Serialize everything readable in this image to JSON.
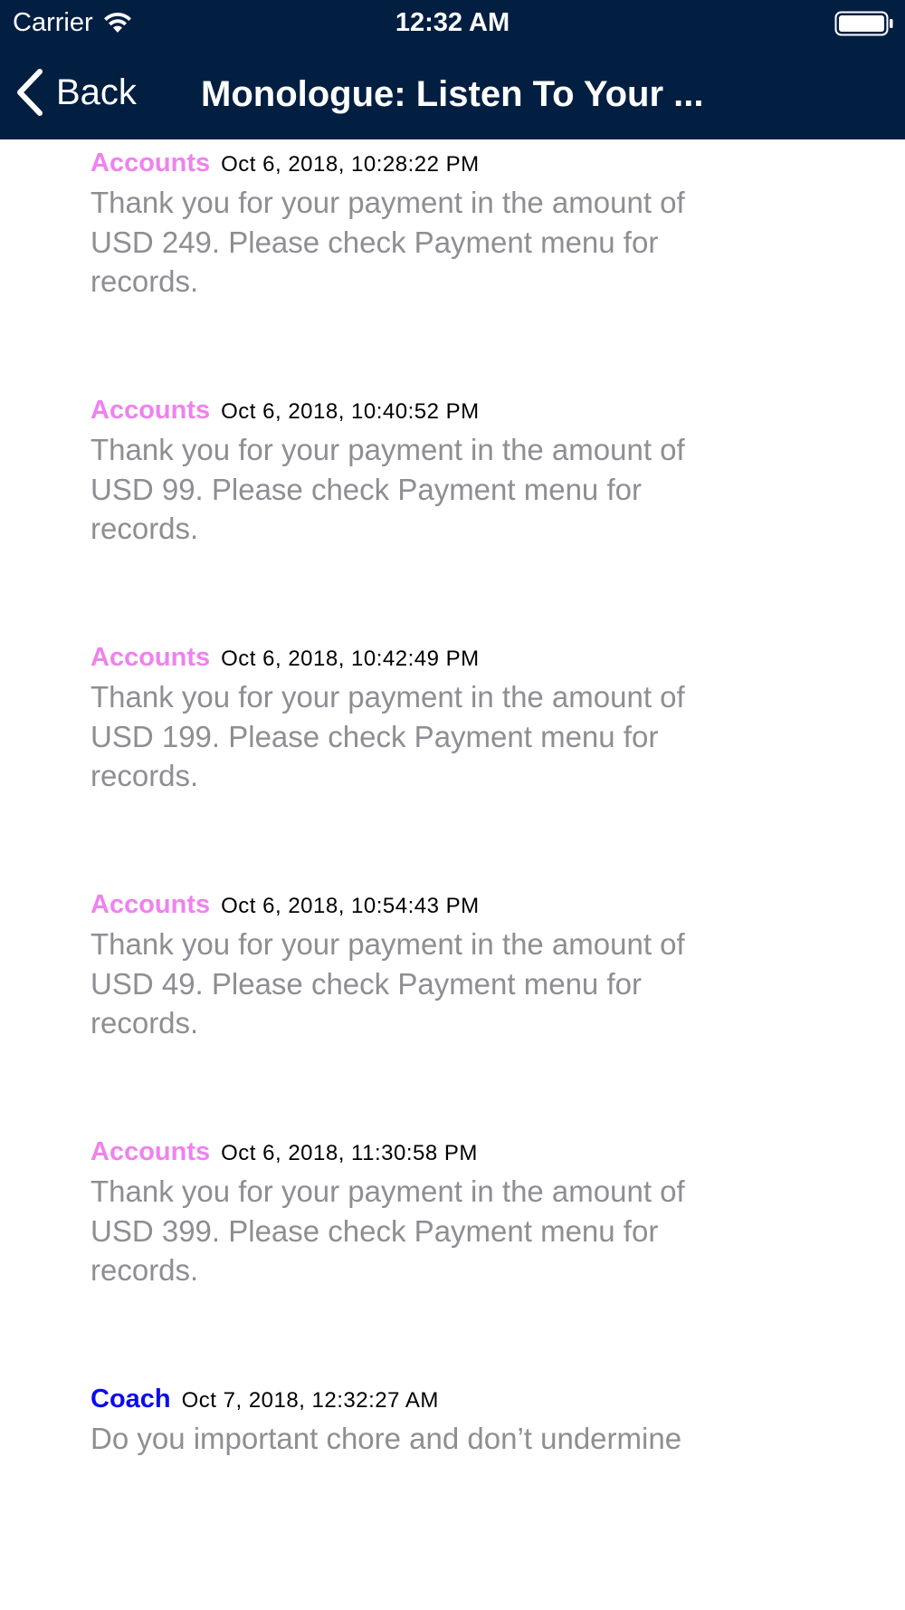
{
  "status_bar": {
    "carrier": "Carrier",
    "time": "12:32 AM"
  },
  "nav": {
    "back_label": "Back",
    "title": "Monologue: Listen To Your ..."
  },
  "colors": {
    "nav_background": "#021f42",
    "accounts_sender": "#ee82ee",
    "coach_sender": "#0b0bf0",
    "message_text": "#8e8e93"
  },
  "messages": [
    {
      "sender": "Accounts",
      "timestamp": "Oct 6, 2018, 10:28:22 PM",
      "body": "Thank you for your payment in the amount of USD 249. Please check Payment menu for records."
    },
    {
      "sender": "Accounts",
      "timestamp": "Oct 6, 2018, 10:40:52 PM",
      "body": "Thank you for your payment in the amount of USD 99. Please check Payment menu for records."
    },
    {
      "sender": "Accounts",
      "timestamp": "Oct 6, 2018, 10:42:49 PM",
      "body": "Thank you for your payment in the amount of USD 199. Please check Payment menu for records."
    },
    {
      "sender": "Accounts",
      "timestamp": "Oct 6, 2018, 10:54:43 PM",
      "body": "Thank you for your payment in the amount of USD 49. Please check Payment menu for records."
    },
    {
      "sender": "Accounts",
      "timestamp": "Oct 6, 2018, 11:30:58 PM",
      "body": "Thank you for your payment in the amount of USD 399. Please check Payment menu for records."
    },
    {
      "sender": "Coach",
      "timestamp": "Oct 7, 2018, 12:32:27 AM",
      "body": "Do you important chore and don’t undermine"
    }
  ]
}
